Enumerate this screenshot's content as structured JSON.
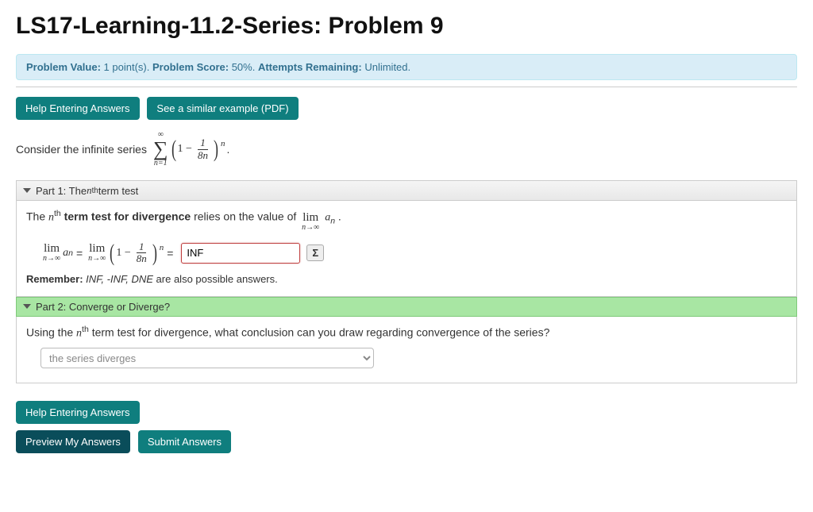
{
  "title": "LS17-Learning-11.2-Series: Problem 9",
  "info": {
    "value_label": "Problem Value:",
    "value": "1 point(s).",
    "score_label": "Problem Score:",
    "score": "50%.",
    "attempts_label": "Attempts Remaining:",
    "attempts": "Unlimited."
  },
  "buttons": {
    "help": "Help Entering Answers",
    "example": "See a similar example (PDF)",
    "preview": "Preview My Answers",
    "submit": "Submit Answers"
  },
  "prompt": {
    "lead": "Consider the infinite series",
    "sum_top": "∞",
    "sum_sym": "∑",
    "sum_bot": "n=1",
    "one_minus": "1 −",
    "frac_num": "1",
    "frac_den": "8n",
    "power": "n",
    "tail": "."
  },
  "part1": {
    "header_pre": "Part 1: The ",
    "header_math": "n",
    "header_sup": "th",
    "header_post": " term test",
    "body_pre": "The ",
    "body_math": "n",
    "body_sup": "th",
    "body_bold": " term test for divergence",
    "body_mid": " relies on the value of ",
    "lim_word": "lim",
    "lim_sub": "n→∞",
    "a": "a",
    "sub_n": "n",
    "period": " .",
    "equals1": " = ",
    "equals2": " = ",
    "answer_value": "INF",
    "sigma": "Σ",
    "remember_label": "Remember:",
    "remember_text": " INF, -INF, DNE",
    "remember_tail": " are also possible answers."
  },
  "part2": {
    "header": "Part 2: Converge or Diverge?",
    "q_pre": "Using the ",
    "q_math": "n",
    "q_sup": "th",
    "q_post": " term test for divergence, what conclusion can you draw regarding convergence of the series?",
    "select_value": "the series diverges"
  }
}
